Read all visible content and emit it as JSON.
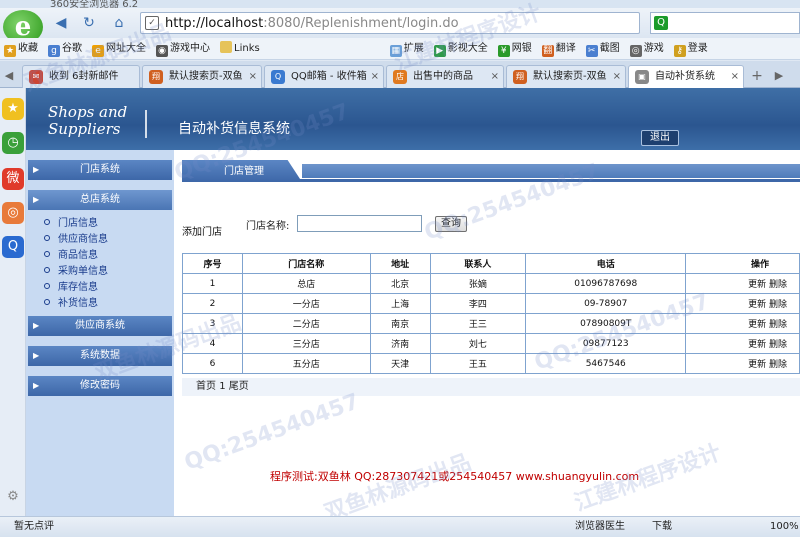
{
  "browser": {
    "title": "360安全浏览器 6.2",
    "url_host": "http://localhost",
    "url_rest": ":8080/Replenishment/login.do",
    "bookmarks": [
      "收藏",
      "谷歌",
      "网址大全",
      "游戏中心",
      "Links",
      "扩展",
      "影视大全",
      "网银",
      "翻译",
      "截图",
      "游戏",
      "登录"
    ],
    "tabs": [
      "收到 6封新邮件",
      "默认搜索页-双鱼",
      "QQ邮箱 - 收件箱",
      "出售中的商品",
      "默认搜索页-双鱼",
      "自动补货系统"
    ],
    "status_left": "暂无点评",
    "status_items": [
      "浏览器医生",
      "下载",
      "100%"
    ]
  },
  "header": {
    "brand_line1": "Shops and",
    "brand_line2": "Suppliers",
    "system_title": "自动补货信息系统",
    "logout": "退出"
  },
  "menu": {
    "groups": [
      {
        "label": "门店系统"
      },
      {
        "label": "总店系统"
      },
      {
        "label": "供应商系统"
      },
      {
        "label": "系统数据"
      },
      {
        "label": "修改密码"
      }
    ],
    "subitems": [
      "门店信息",
      "供应商信息",
      "商品信息",
      "采购单信息",
      "库存信息",
      "补货信息"
    ]
  },
  "content": {
    "tab_title": "门店管理",
    "add_link": "添加门店",
    "search_label": "门店名称:",
    "search_value": "",
    "search_button": "查询",
    "columns": [
      "序号",
      "门店名称",
      "地址",
      "联系人",
      "电话",
      "操作"
    ],
    "rows": [
      {
        "no": "1",
        "name": "总店",
        "addr": "北京",
        "contact": "张嫡",
        "phone": "01096787698",
        "op1": "更新",
        "op2": "删除"
      },
      {
        "no": "2",
        "name": "一分店",
        "addr": "上海",
        "contact": "李四",
        "phone": "09-78907",
        "op1": "更新",
        "op2": "删除"
      },
      {
        "no": "3",
        "name": "二分店",
        "addr": "南京",
        "contact": "王三",
        "phone": "07890809T",
        "op1": "更新",
        "op2": "删除"
      },
      {
        "no": "4",
        "name": "三分店",
        "addr": "济南",
        "contact": "刘七",
        "phone": "09877123",
        "op1": "更新",
        "op2": "删除"
      },
      {
        "no": "6",
        "name": "五分店",
        "addr": "天津",
        "contact": "王五",
        "phone": "5467546",
        "op1": "更新",
        "op2": "删除"
      }
    ],
    "pager_first": "首页",
    "pager_current": "1",
    "pager_last": "尾页",
    "credit": "程序测试:双鱼林 QQ:287307421或254540457 www.shuangyulin.com"
  },
  "watermarks": [
    "QQ:254540457",
    "江建林程序设计",
    "双鱼林源码出品"
  ]
}
